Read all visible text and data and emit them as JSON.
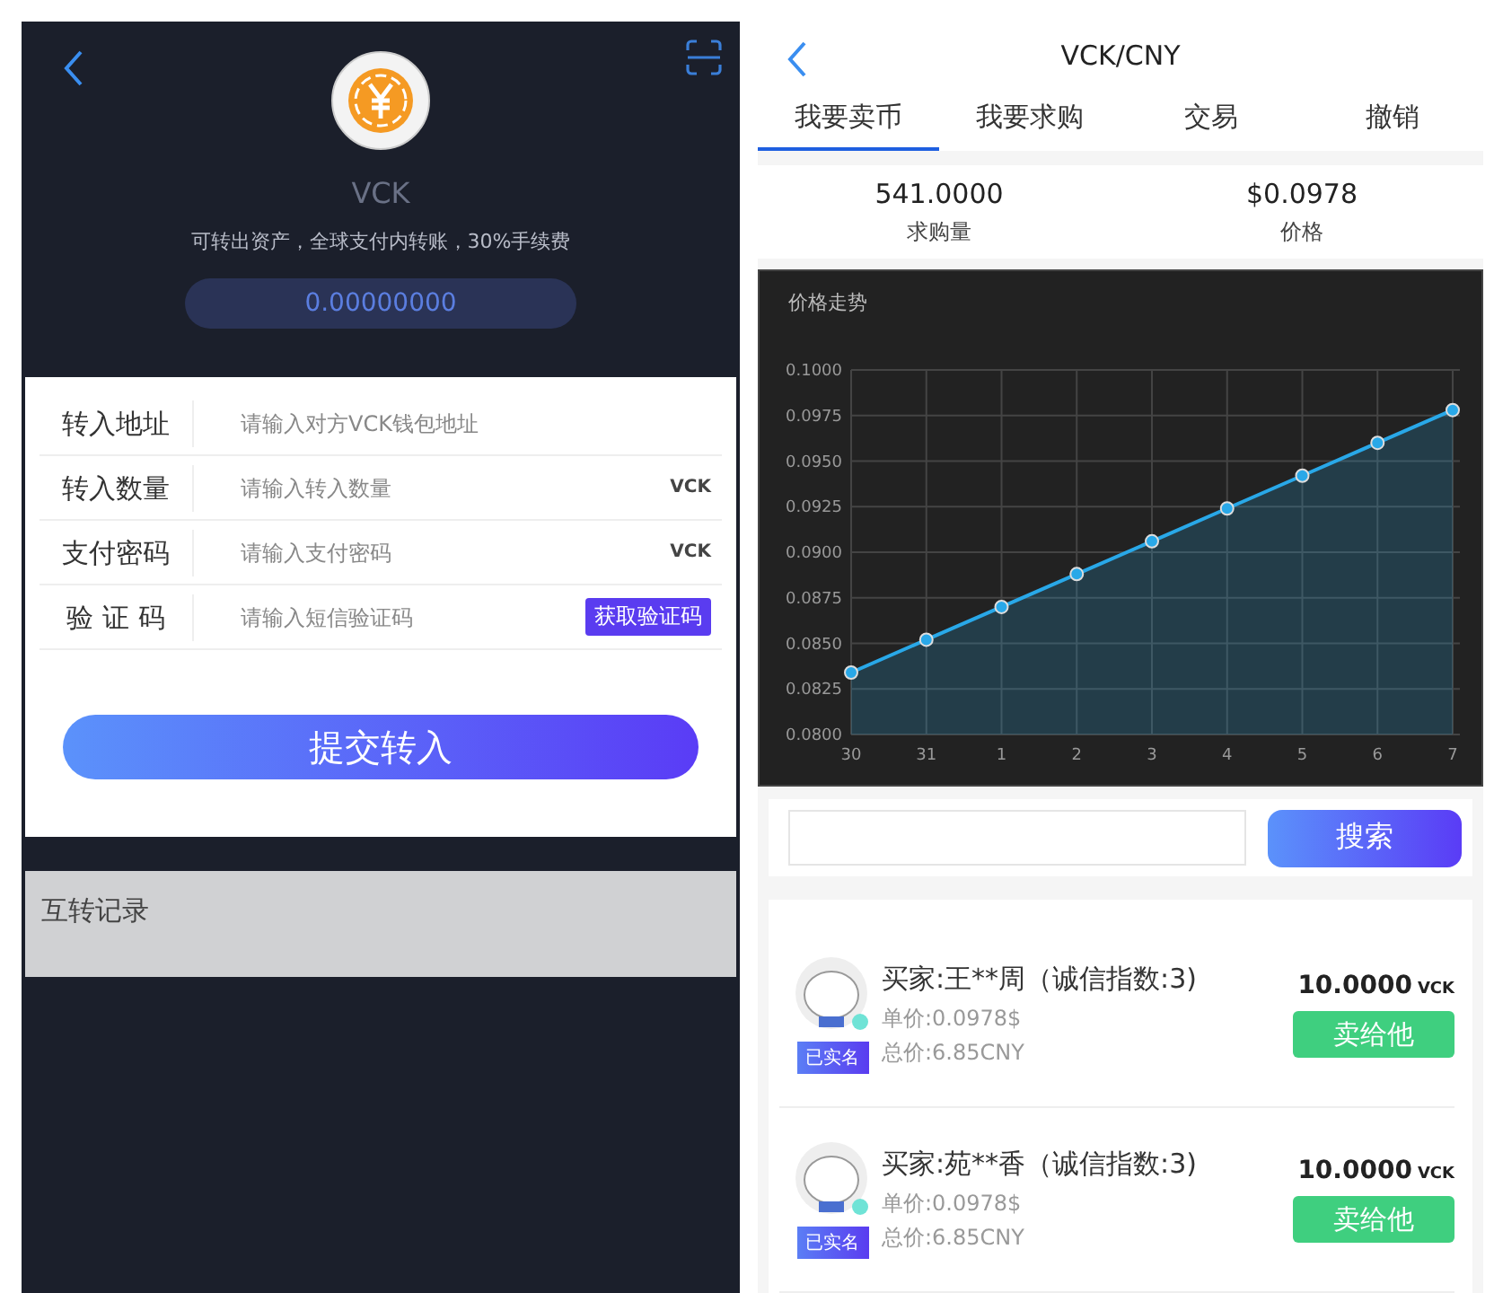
{
  "left": {
    "coin_name": "VCK",
    "subtitle": "可转出资产，全球支付内转账，30%手续费",
    "balance": "0.00000000",
    "form": [
      {
        "kind": "plain",
        "label": "转入地址",
        "placeholder": "请输入对方VCK钱包地址"
      },
      {
        "kind": "unit",
        "label": "转入数量",
        "placeholder": "请输入转入数量",
        "suffix": "VCK"
      },
      {
        "kind": "unit",
        "label": "支付密码",
        "placeholder": "请输入支付密码",
        "suffix": "VCK"
      },
      {
        "kind": "code",
        "label": "验 证 码",
        "placeholder": "请输入短信验证码",
        "suffix": "获取验证码"
      }
    ],
    "submit": "提交转入",
    "records_title": "互转记录"
  },
  "right": {
    "title": "VCK/CNY",
    "tabs": [
      {
        "label": "我要卖币",
        "selected": true
      },
      {
        "label": "我要求购",
        "selected": false
      },
      {
        "label": "交易",
        "selected": false
      },
      {
        "label": "撤销",
        "selected": false
      }
    ],
    "stats": [
      {
        "value": "541.0000",
        "label": "求购量"
      },
      {
        "value": "$0.0978",
        "label": "价格"
      }
    ],
    "chart": {
      "chart_data": {
        "type": "area",
        "title": "价格走势",
        "categories": [
          "30",
          "31",
          "1",
          "2",
          "3",
          "4",
          "5",
          "6",
          "7"
        ],
        "grid": true,
        "series": [
          {
            "color": "#29a8e8",
            "values": [
              0.0834,
              0.0852,
              0.087,
              0.0888,
              0.0906,
              0.0924,
              0.0942,
              0.096,
              0.0978
            ]
          }
        ],
        "ylim": [
          0.08,
          0.1
        ],
        "yticks": [
          {
            "value": 0.08,
            "label": "0.0800"
          },
          {
            "value": 0.0825,
            "label": "0.0825"
          },
          {
            "value": 0.085,
            "label": "0.0850"
          },
          {
            "value": 0.0875,
            "label": "0.0875"
          },
          {
            "value": 0.09,
            "label": "0.0900"
          },
          {
            "value": 0.0925,
            "label": "0.0925"
          },
          {
            "value": 0.095,
            "label": "0.0950"
          },
          {
            "value": 0.0975,
            "label": "0.0975"
          },
          {
            "value": 0.1,
            "label": "0.1000"
          }
        ]
      }
    },
    "search_button": "搜索",
    "orders": [
      {
        "buyer": "买家:王**周（诚信指数:3)",
        "badge": "已实名",
        "unit_price": "单价:0.0978$",
        "total": "总价:6.85CNY",
        "amount": "10.0000",
        "amount_unit": "VCK",
        "action": "卖给他"
      },
      {
        "buyer": "买家:苑**香（诚信指数:3)",
        "badge": "已实名",
        "unit_price": "单价:0.0978$",
        "total": "总价:6.85CNY",
        "amount": "10.0000",
        "amount_unit": "VCK",
        "action": "卖给他"
      }
    ]
  }
}
